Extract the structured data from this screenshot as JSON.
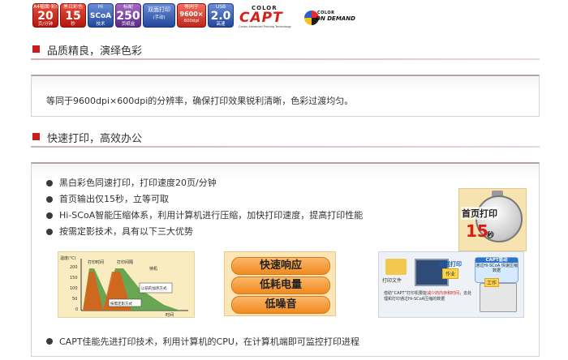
{
  "badges": [
    {
      "top": "A4幅面·彩色",
      "big": "20",
      "bot": "页/分钟",
      "style": "red"
    },
    {
      "top": "黑白彩色",
      "big": "15",
      "bot": "秒",
      "style": "red"
    },
    {
      "top": "Hi",
      "big": "SCoA",
      "bot": "技术",
      "style": "blue"
    },
    {
      "top": "标配",
      "big": "250",
      "bot": "页纸盒",
      "style": "purple"
    },
    {
      "top": "双面打印",
      "big": "",
      "bot": "(手动)",
      "style": "blue"
    },
    {
      "top": "等同于",
      "big": "9600×",
      "bot": "600dpi",
      "style": "red2"
    },
    {
      "top": "USB",
      "big": "2.0",
      "bot": "高速",
      "style": "blue"
    }
  ],
  "capt_logo": {
    "color": "COLOR",
    "word": "CAPT",
    "sub": "Canon Advanced Printing Technology"
  },
  "cod_logo": {
    "line1": "COLOR",
    "line2": "ON DEMAND"
  },
  "section1": {
    "title": "品质精良，演绎色彩",
    "text": "等同于9600dpi×600dpi的分辨率，确保打印效果锐利清晰，色彩过渡均匀。"
  },
  "section2": {
    "title": "快速打印，高效办公",
    "bullets": [
      "黑白彩色同速打印，打印速度20页/分钟",
      "首页输出仅15秒，立等可取",
      "Hi-SCoA智能压缩体系，利用计算机进行压缩，加快打印速度，提高打印性能",
      "按需定影技术，具有以下三大优势"
    ],
    "last_bullet": "CAPT佳能先进打印技术，利用计算机的CPU，在计算机端即可监控打印进程",
    "stopwatch": {
      "line1": "首页打印",
      "number": "15",
      "unit": "秒"
    },
    "chart": {
      "ylabel": "温度(℃)",
      "xlabel": "时间",
      "ticks": [
        "200",
        "150",
        "100",
        "50",
        "0"
      ],
      "labels": [
        "打印时间",
        "打印间隔",
        "待机",
        "以前的加热方式",
        "按需定影方式"
      ]
    },
    "features": [
      "快速响应",
      "低耗电量",
      "低噪音"
    ],
    "computer": {
      "file_label": "打印文件",
      "send_label": "发送打印",
      "task_label": "作业",
      "bubble_title": "CAPT驱动",
      "bubble_text": "通过Hi-SCoA 快速压缩数据",
      "printer_tag": "工作",
      "desc_part1": "借助“CAPT”打印机要能",
      "desc_red": "减少的内存和时间",
      "desc_part2": "，去处理和打印通过Hi-SCoA压缩的数据"
    }
  },
  "colors": {
    "accent": "#c91d1d",
    "rule": "#c9b5b5"
  }
}
